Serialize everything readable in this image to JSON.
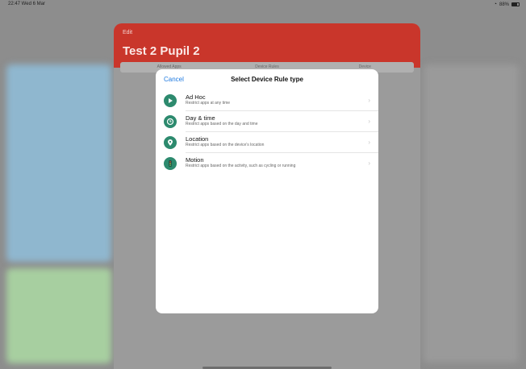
{
  "status": {
    "time": "22:47  Wed 6 Mar",
    "battery": "88%"
  },
  "sheet": {
    "edit_label": "Edit",
    "title": "Test 2 Pupil 2",
    "tabs": [
      "Allowed Apps",
      "Device Rules",
      "Device"
    ]
  },
  "modal": {
    "cancel_label": "Cancel",
    "title": "Select Device Rule type",
    "items": [
      {
        "title": "Ad Hoc",
        "subtitle": "Restrict apps at any time",
        "icon": "play-icon"
      },
      {
        "title": "Day & time",
        "subtitle": "Restrict apps based on the day and time",
        "icon": "clock-icon"
      },
      {
        "title": "Location",
        "subtitle": "Restrict apps based on the device's location",
        "icon": "location-pin-icon"
      },
      {
        "title": "Motion",
        "subtitle": "Restrict apps based on the activity, such as cycling or running",
        "icon": "traffic-light-icon"
      }
    ]
  },
  "colors": {
    "header_red": "#c9362b",
    "accent_blue": "#1f7ae0",
    "icon_green": "#2d8a6e"
  }
}
